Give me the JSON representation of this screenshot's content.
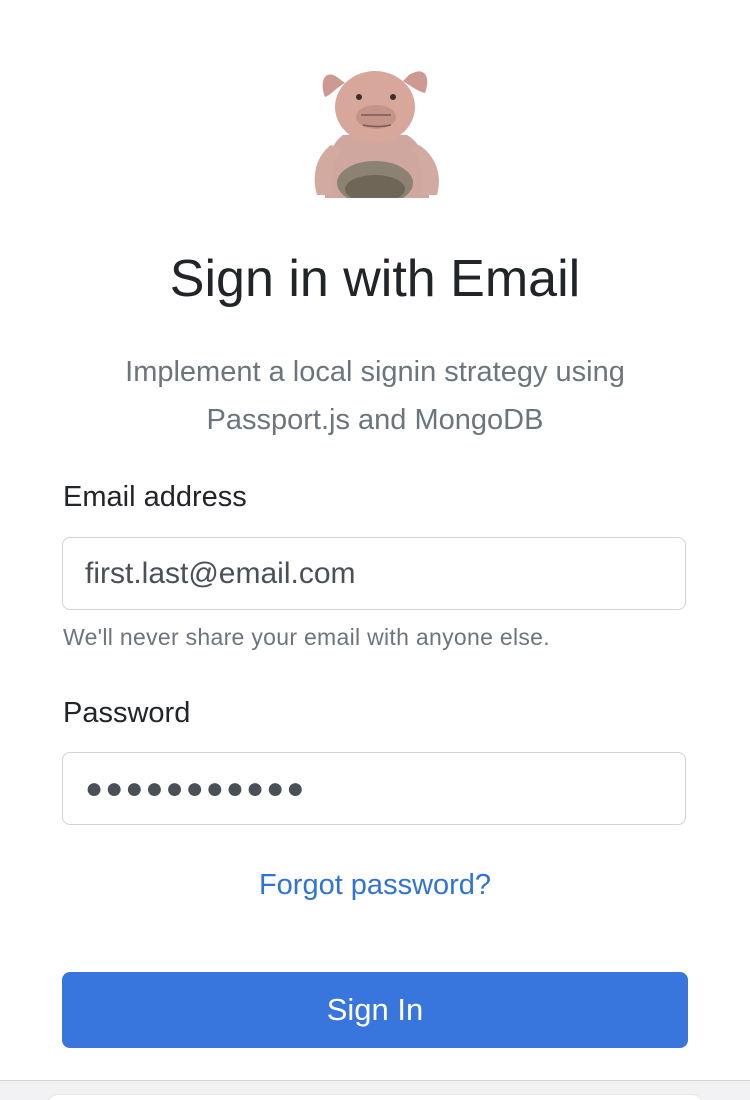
{
  "header": {
    "logo_icon": "stuffed-pig-icon",
    "title": "Sign in with Email",
    "subtitle": "Implement a local signin strategy using Passport.js and MongoDB"
  },
  "form": {
    "email": {
      "label": "Email address",
      "value": "first.last@email.com",
      "help": "We'll never share your email with anyone else."
    },
    "password": {
      "label": "Password",
      "masked_value": "●●●●●●●●●●●"
    },
    "forgot_label": "Forgot password?",
    "submit_label": "Sign In"
  },
  "colors": {
    "primary": "#3876dd",
    "link": "#2f74d6",
    "muted": "#6c757d",
    "border": "#ced4da"
  }
}
